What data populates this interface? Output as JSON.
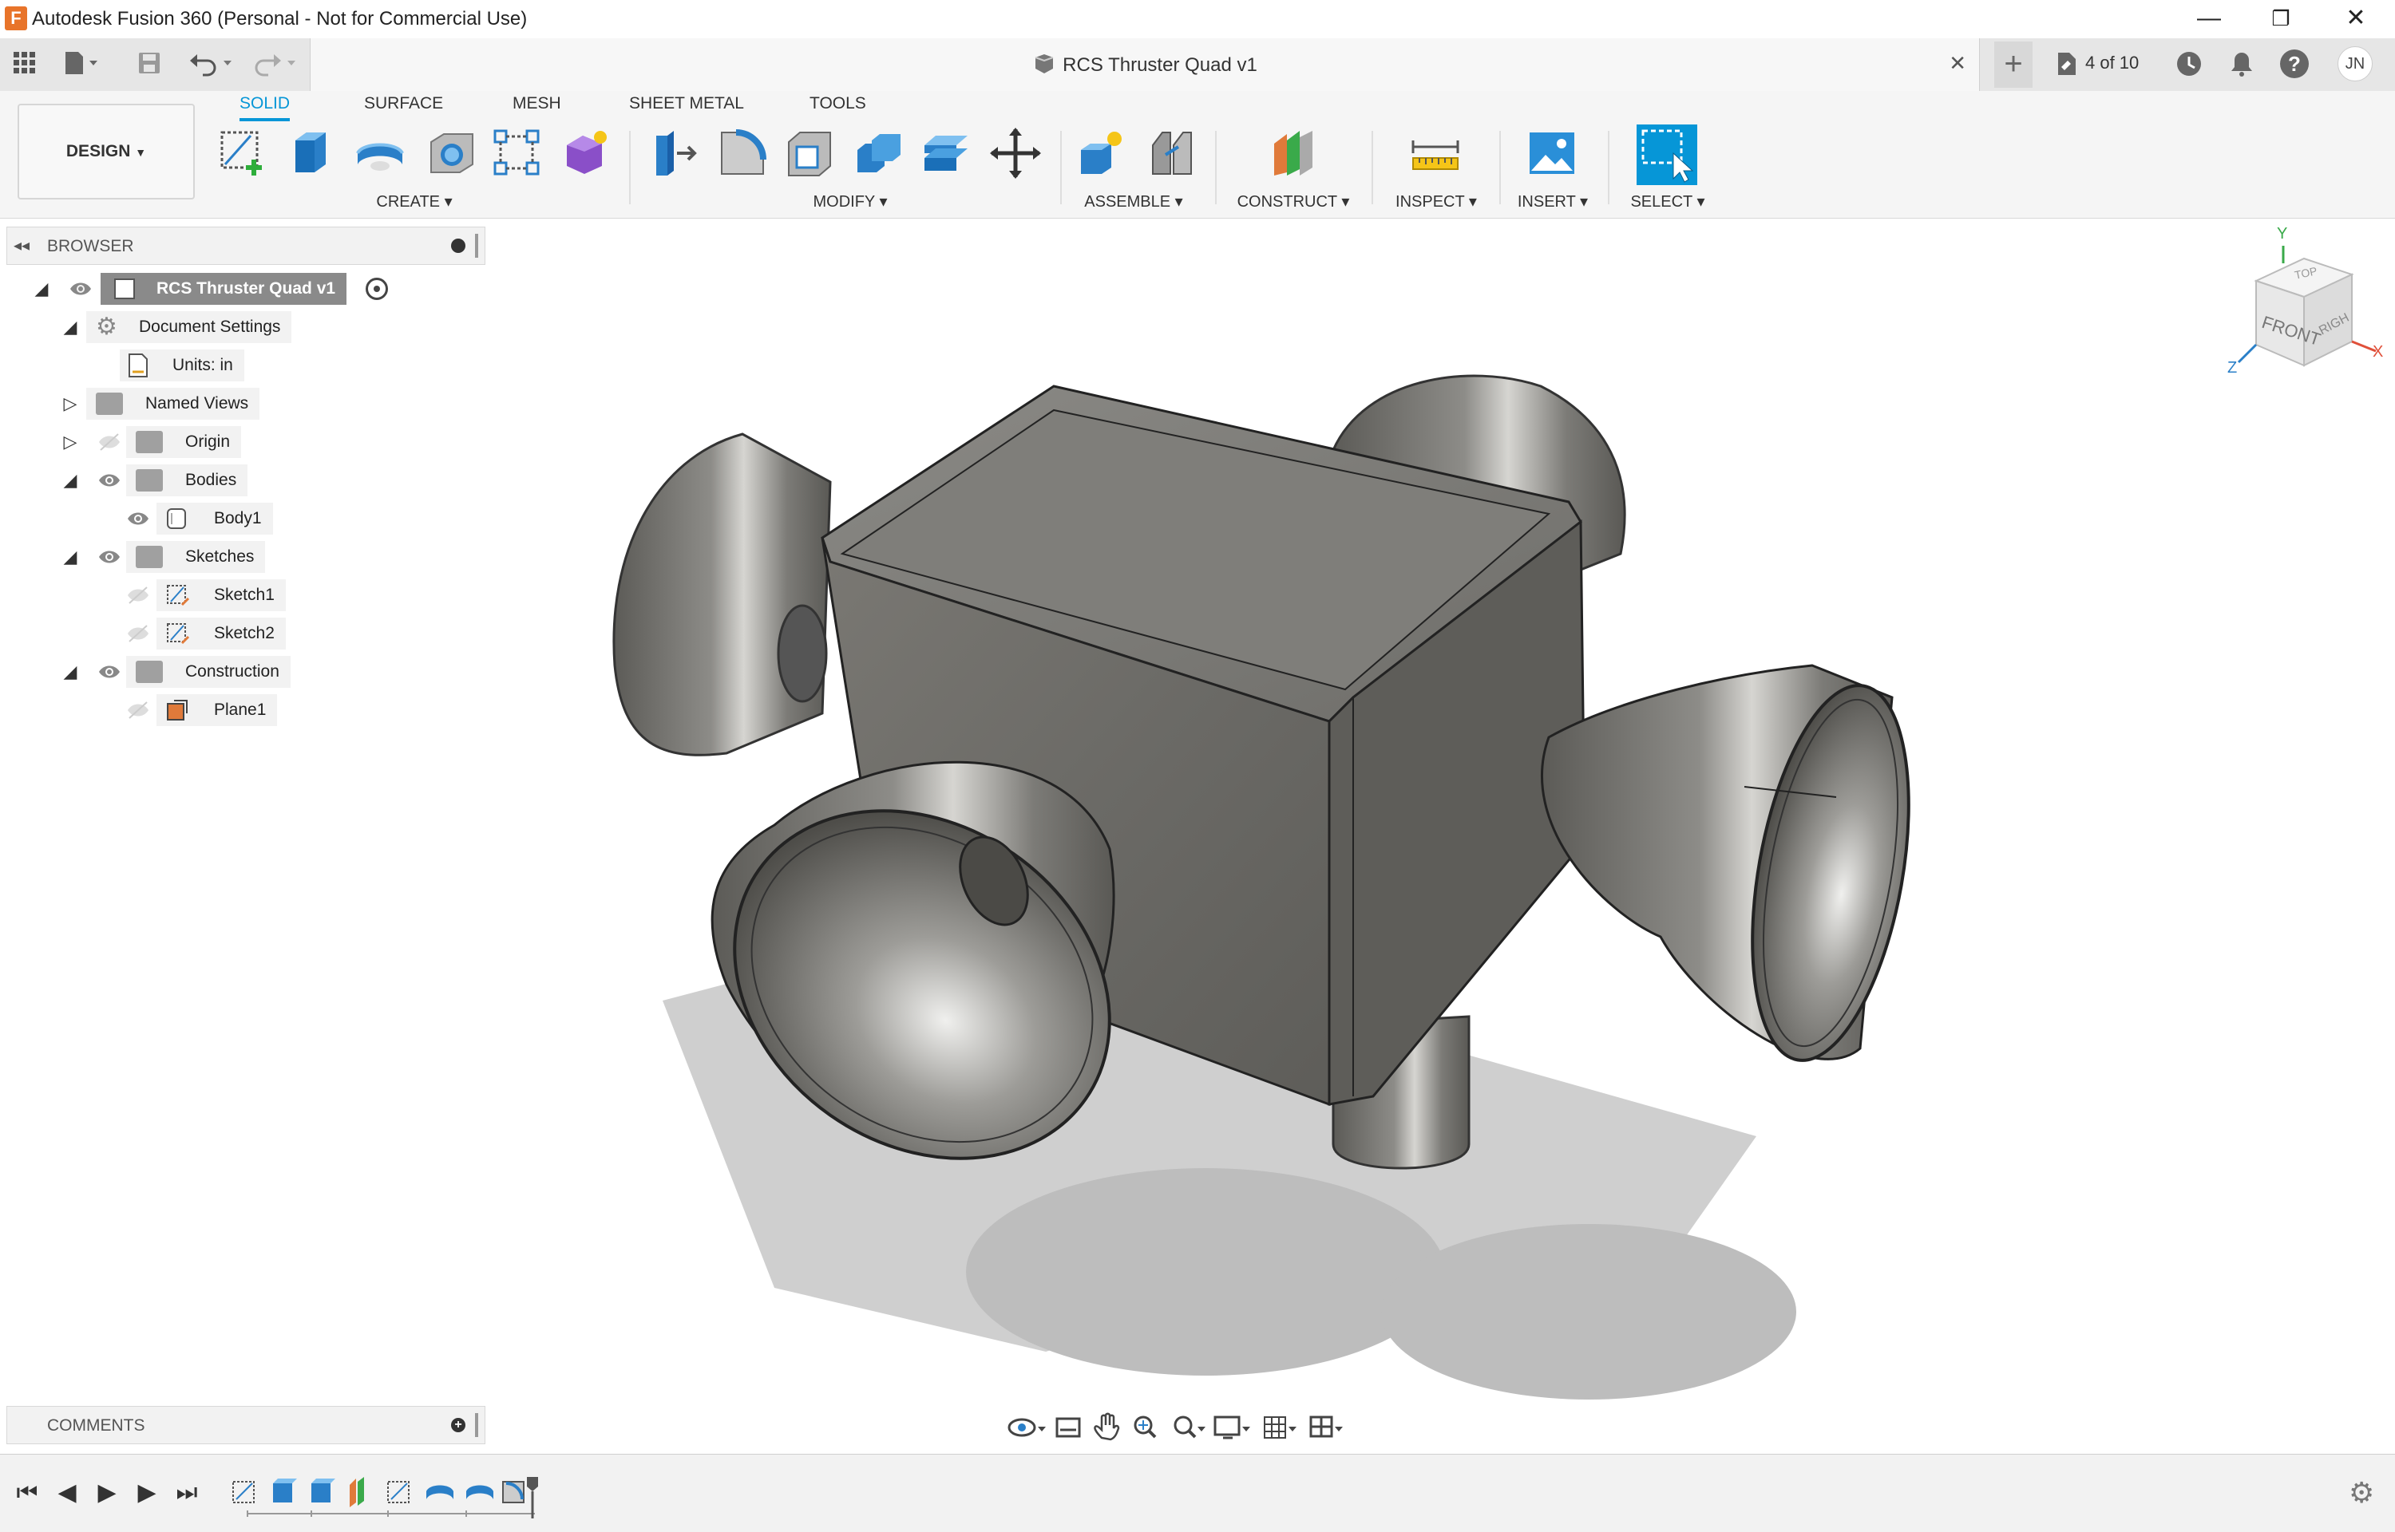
{
  "window": {
    "title": "Autodesk Fusion 360 (Personal - Not for Commercial Use)",
    "logo_letter": "F",
    "minimize": "—",
    "maximize": "❐",
    "close": "✕"
  },
  "tabbar": {
    "document_title": "RCS Thruster Quad v1",
    "close_tab": "✕",
    "new_tab": "+",
    "job_status": "4 of 10",
    "user_initials": "JN"
  },
  "toolbar": {
    "workspace": "DESIGN",
    "tabs": [
      "SOLID",
      "SURFACE",
      "MESH",
      "SHEET METAL",
      "TOOLS"
    ],
    "groups": {
      "create": "CREATE",
      "modify": "MODIFY",
      "assemble": "ASSEMBLE",
      "construct": "CONSTRUCT",
      "inspect": "INSPECT",
      "insert": "INSERT",
      "select": "SELECT"
    }
  },
  "browser": {
    "label": "BROWSER",
    "root": "RCS Thruster Quad v1",
    "items": {
      "document_settings": "Document Settings",
      "units": "Units: in",
      "named_views": "Named Views",
      "origin": "Origin",
      "bodies": "Bodies",
      "body1": "Body1",
      "sketches": "Sketches",
      "sketch1": "Sketch1",
      "sketch2": "Sketch2",
      "construction": "Construction",
      "plane1": "Plane1"
    }
  },
  "viewcube": {
    "top": "TOP",
    "front": "FRONT",
    "right": "RIGHT",
    "x": "X",
    "y": "Y",
    "z": "Z"
  },
  "comments": {
    "label": "COMMENTS"
  },
  "colors": {
    "accent": "#0696d7",
    "body": "#6b6a66",
    "logo": "#e8742a"
  }
}
